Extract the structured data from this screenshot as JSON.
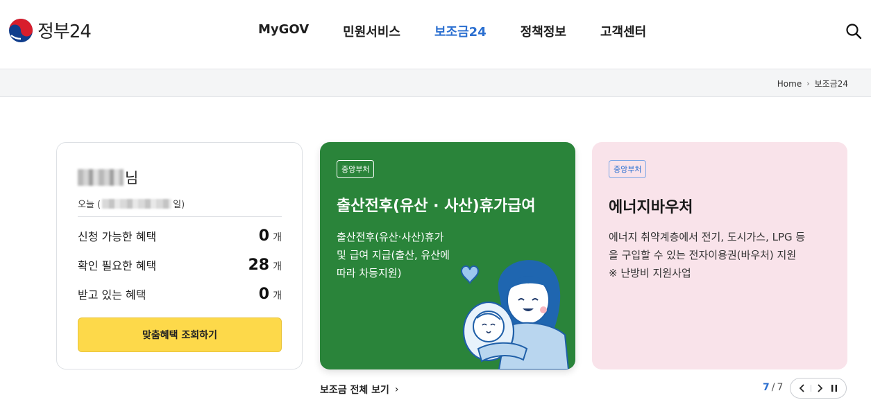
{
  "header": {
    "logo_text": "정부24",
    "nav": [
      "MyGOV",
      "민원서비스",
      "보조금24",
      "정책정보",
      "고객센터"
    ],
    "active_nav": "보조금24"
  },
  "breadcrumb": {
    "home": "Home",
    "current": "보조금24"
  },
  "user_card": {
    "name_suffix": "님",
    "date_prefix": "오늘 (",
    "date_suffix": "일)",
    "benefits": [
      {
        "label": "신청 가능한 혜택",
        "count": "0",
        "unit": "개"
      },
      {
        "label": "확인 필요한 혜택",
        "count": "28",
        "unit": "개"
      },
      {
        "label": "받고 있는 혜택",
        "count": "0",
        "unit": "개"
      }
    ],
    "cta": "맞춤혜택 조회하기"
  },
  "cards": {
    "green": {
      "badge": "중앙부처",
      "title": "출산전후(유산 · 사산)휴가급여",
      "desc_lines": [
        "출산전후(유산·사산)휴가",
        "및 급여 지급(출산, 유산에",
        "따라 차등지원)"
      ],
      "bg_color": "#2a843a"
    },
    "pink": {
      "badge": "중앙부처",
      "title": "에너지바우처",
      "desc_lines": [
        "에너지 취약계층에서 전기, 도시가스, LPG 등",
        "을 구입할 수 있는 전자이용권(바우처) 지원",
        "※ 난방비 지원사업"
      ],
      "bg_color": "#f9e3ea"
    }
  },
  "see_all": "보조금 전체 보기",
  "pager": {
    "current": "7",
    "total": "7"
  },
  "colors": {
    "accent": "#2b6fd0",
    "cta": "#fdd94a"
  }
}
